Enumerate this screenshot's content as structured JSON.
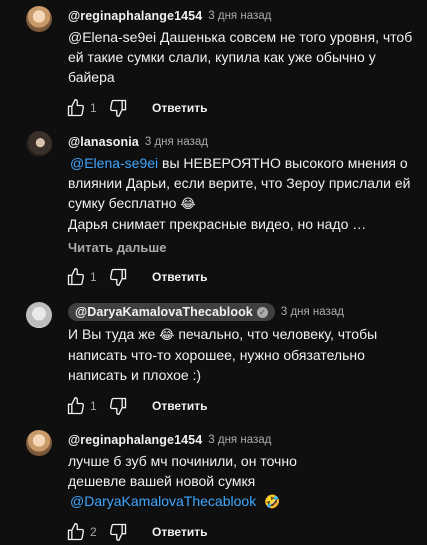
{
  "comments": [
    {
      "author": "@reginaphalange1454",
      "time": "3 дня назад",
      "text": "@Elena-se9ei  Дашенька совсем не того уровня, чтоб ей такие сумки слали, купила как уже обычно у байера",
      "likes": "1",
      "reply": "Ответить",
      "avatar": "blonde-avatar"
    },
    {
      "author": "@lanasonia",
      "time": "3 дня назад",
      "mention": "@Elena-se9ei",
      "text_after_mention": " вы НЕВЕРОЯТНО высокого мнения о влиянии Дарьи, если верите, что Зероу прислали ей сумку бесплатно ",
      "emoji1": "😂",
      "text_line4": "Дарья снимает прекрасные видео, но надо …",
      "read_more": "Читать дальше",
      "likes": "1",
      "reply": "Ответить",
      "avatar": "dark-avatar"
    },
    {
      "author": "@DaryaKamalovaThecablook",
      "time": "3 дня назад",
      "text_before_emoji": "И Вы туда же ",
      "emoji1": "😂",
      "text_after_emoji": " печально, что человеку, чтобы написать что-то хорошее, нужно обязательно написать и плохое :)",
      "likes": "1",
      "reply": "Ответить",
      "avatar": "white-avatar",
      "verified": "✓"
    },
    {
      "author": "@reginaphalange1454",
      "time": "3 дня назад",
      "text": "лучше б зуб мч починили, он точно дешевле вашей новой сумкя",
      "mention": "@DaryaKamalovaThecablook",
      "emoji1": "🤣",
      "likes": "2",
      "reply": "Ответить",
      "avatar": "blonde-avatar"
    }
  ],
  "colors": {
    "background": "#0f0f0f",
    "text": "#f1f1f1",
    "secondary": "#aaaaaa",
    "link": "#3ea6ff"
  },
  "icons": [
    "thumb-up-icon",
    "thumb-down-icon",
    "check-icon"
  ]
}
